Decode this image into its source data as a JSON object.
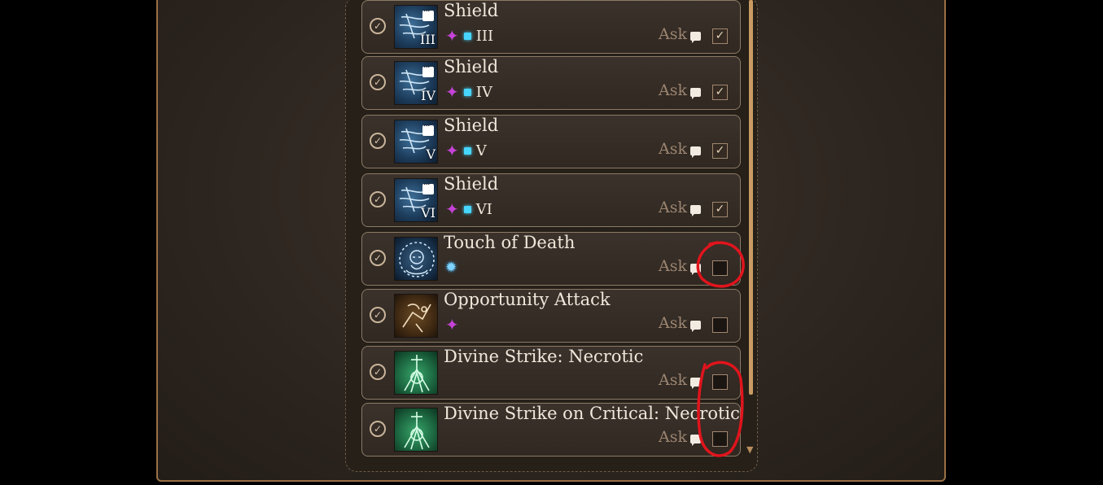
{
  "ask_label": "Ask",
  "rows": [
    {
      "name": "Shield",
      "roman": "III",
      "level": "III",
      "icon": "shield",
      "checked": true
    },
    {
      "name": "Shield",
      "roman": "IV",
      "level": "IV",
      "icon": "shield",
      "checked": true
    },
    {
      "name": "Shield",
      "roman": "V",
      "level": "V",
      "icon": "shield",
      "checked": true
    },
    {
      "name": "Shield",
      "roman": "VI",
      "level": "VI",
      "icon": "shield",
      "checked": true
    },
    {
      "name": "Touch of Death",
      "icon": "death",
      "checked": false
    },
    {
      "name": "Opportunity Attack",
      "icon": "opp",
      "checked": false
    },
    {
      "name": "Divine Strike: Necrotic",
      "icon": "divine",
      "checked": false
    },
    {
      "name": "Divine Strike on Critical: Necrotic",
      "icon": "divine",
      "checked": false
    }
  ],
  "colors": {
    "accent": "#c99a62",
    "reaction": "#c542d8",
    "spell_slot": "#46d6ff",
    "annotation": "#e0141c"
  }
}
